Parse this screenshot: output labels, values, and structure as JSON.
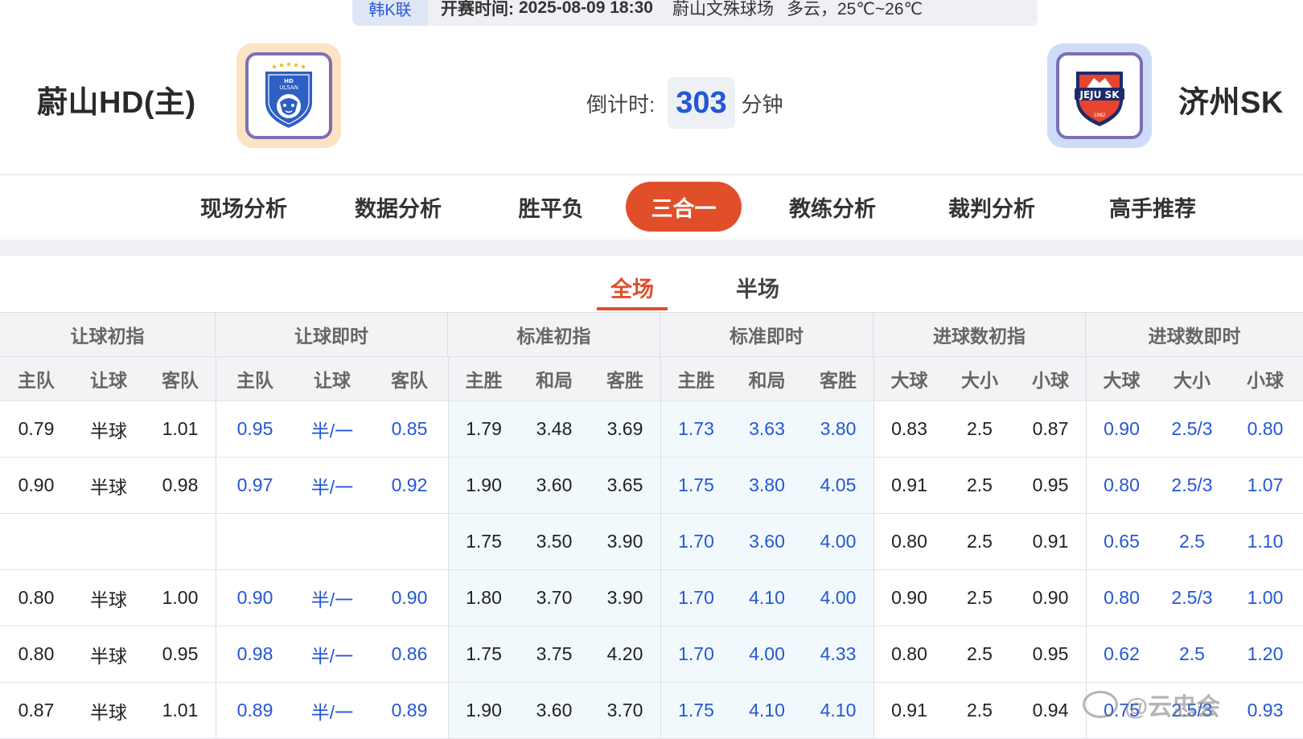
{
  "match_info": {
    "league": "韩K联",
    "kickoff_label": "开赛时间:",
    "kickoff_time": "2025-08-09 18:30",
    "venue": "蔚山文殊球场",
    "weather": "多云，25℃~26℃"
  },
  "home": {
    "name": "蔚山HD(主)",
    "logo_text": "HD ULSAN"
  },
  "away": {
    "name": "济州SK",
    "logo_text": "JEJU SK",
    "logo_year": "1982"
  },
  "countdown": {
    "label": "倒计时:",
    "value": "303",
    "unit": "分钟"
  },
  "nav": {
    "items": [
      "现场分析",
      "数据分析",
      "胜平负",
      "三合一",
      "教练分析",
      "裁判分析",
      "高手推荐"
    ],
    "active": "三合一"
  },
  "subtabs": {
    "items": [
      "全场",
      "半场"
    ],
    "active": "全场"
  },
  "table": {
    "groups": [
      "让球初指",
      "让球即时",
      "标准初指",
      "标准即时",
      "进球数初指",
      "进球数即时"
    ],
    "subheaders": [
      "主队",
      "让球",
      "客队",
      "主队",
      "让球",
      "客队",
      "主胜",
      "和局",
      "客胜",
      "主胜",
      "和局",
      "客胜",
      "大球",
      "大小",
      "小球",
      "大球",
      "大小",
      "小球"
    ],
    "rows": [
      [
        "0.79",
        "半球",
        "1.01",
        "0.95",
        "半/一",
        "0.85",
        "1.79",
        "3.48",
        "3.69",
        "1.73",
        "3.63",
        "3.80",
        "0.83",
        "2.5",
        "0.87",
        "0.90",
        "2.5/3",
        "0.80"
      ],
      [
        "0.90",
        "半球",
        "0.98",
        "0.97",
        "半/一",
        "0.92",
        "1.90",
        "3.60",
        "3.65",
        "1.75",
        "3.80",
        "4.05",
        "0.91",
        "2.5",
        "0.95",
        "0.80",
        "2.5/3",
        "1.07"
      ],
      [
        "",
        "",
        "",
        "",
        "",
        "",
        "1.75",
        "3.50",
        "3.90",
        "1.70",
        "3.60",
        "4.00",
        "0.80",
        "2.5",
        "0.91",
        "0.65",
        "2.5",
        "1.10"
      ],
      [
        "0.80",
        "半球",
        "1.00",
        "0.90",
        "半/一",
        "0.90",
        "1.80",
        "3.70",
        "3.90",
        "1.70",
        "4.10",
        "4.00",
        "0.90",
        "2.5",
        "0.90",
        "0.80",
        "2.5/3",
        "1.00"
      ],
      [
        "0.80",
        "半球",
        "0.95",
        "0.98",
        "半/一",
        "0.86",
        "1.75",
        "3.75",
        "4.20",
        "1.70",
        "4.00",
        "4.33",
        "0.80",
        "2.5",
        "0.95",
        "0.62",
        "2.5",
        "1.20"
      ],
      [
        "0.87",
        "半球",
        "1.01",
        "0.89",
        "半/一",
        "0.89",
        "1.90",
        "3.60",
        "3.70",
        "1.75",
        "4.10",
        "4.10",
        "0.91",
        "2.5",
        "0.94",
        "0.75",
        "2.5/3",
        "0.93"
      ]
    ]
  },
  "watermark": "@云忠会",
  "colors": {
    "accent": "#e04f2a",
    "link_blue": "#2457d6"
  }
}
